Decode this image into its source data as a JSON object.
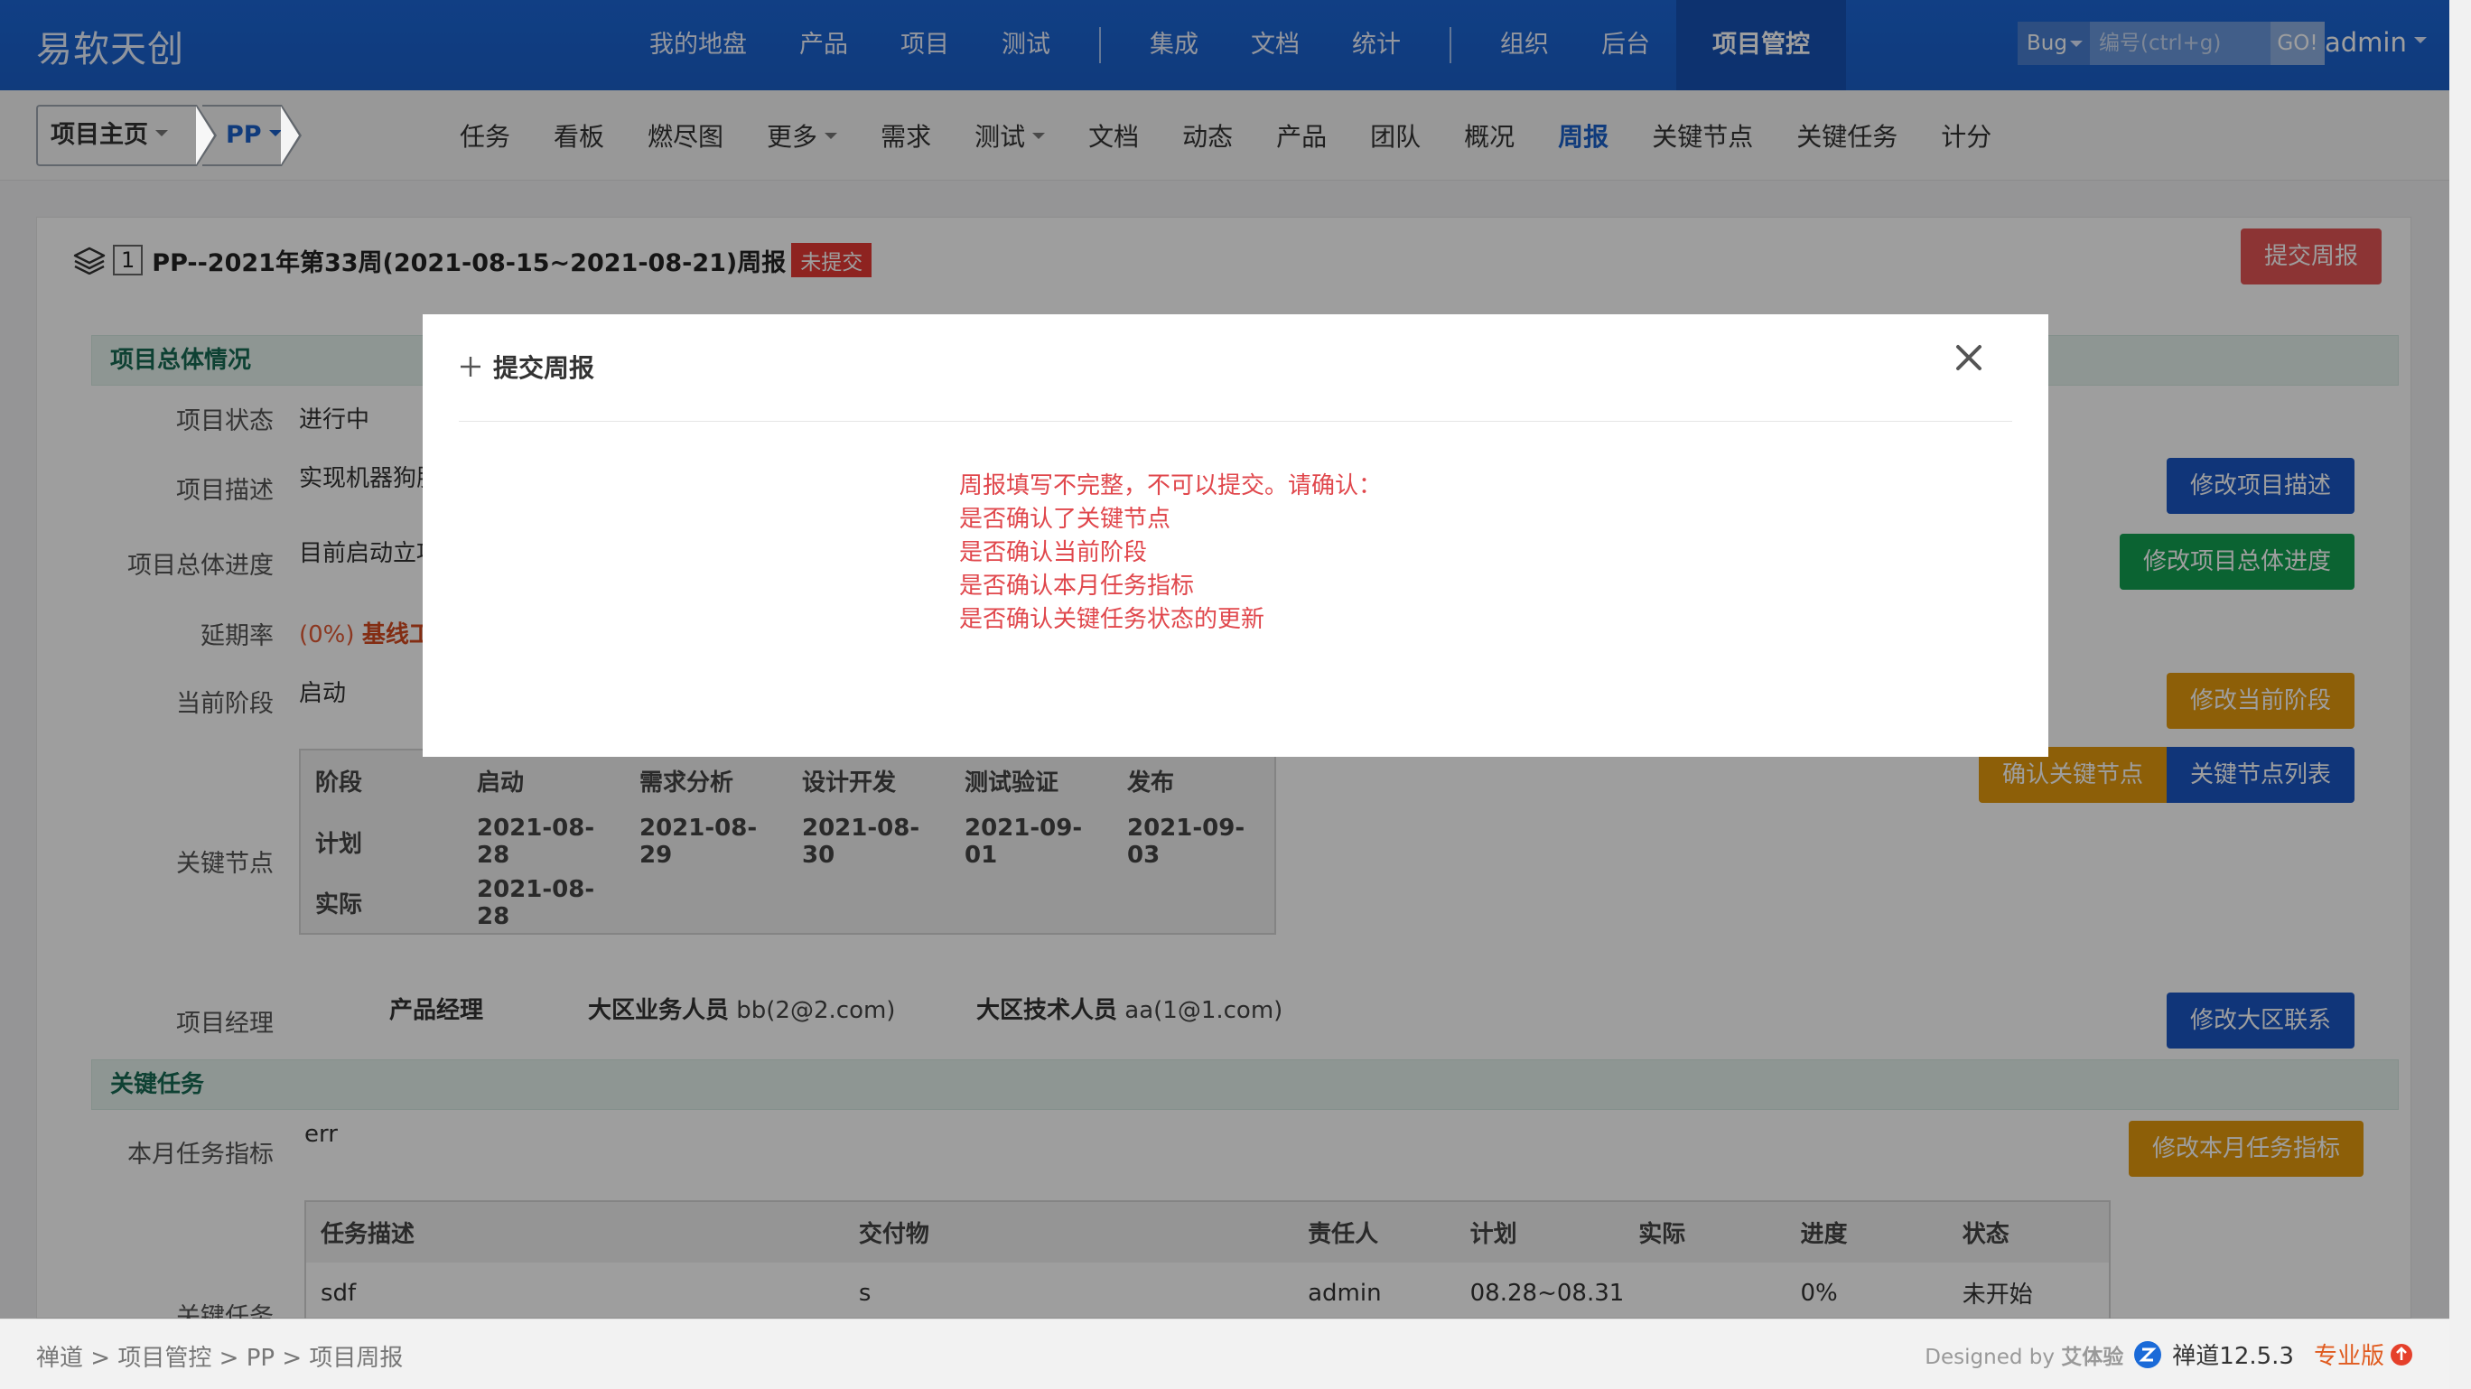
{
  "header": {
    "brand": "易软天创",
    "nav": [
      "我的地盘",
      "产品",
      "项目",
      "测试",
      "集成",
      "文档",
      "统计",
      "组织",
      "后台"
    ],
    "active": "项目管控",
    "search_type": "Bug",
    "search_placeholder": "编号(ctrl+g)",
    "go_label": "GO!",
    "user": "admin"
  },
  "subnav": {
    "home": "项目主页",
    "project": "PP",
    "items": [
      "任务",
      "看板",
      "燃尽图",
      "更多",
      "需求",
      "测试",
      "文档",
      "动态",
      "产品",
      "团队",
      "概况",
      "周报",
      "关键节点",
      "关键任务",
      "计分"
    ],
    "active_index": 11
  },
  "report": {
    "number": "1",
    "title": "PP--2021年第33周(2021-08-15~2021-08-21)周报",
    "status_badge": "未提交",
    "submit_label": "提交周报"
  },
  "overview": {
    "section": "项目总体情况",
    "status_label": "项目状态",
    "status_value": "进行中",
    "desc_label": "项目描述",
    "desc_value": "实现机器狗服",
    "progress_label": "项目总体进度",
    "progress_value": "目前启动立项",
    "delay_label": "延期率",
    "delay_pct": "(0%)",
    "delay_text": "基线工",
    "stage_label": "当前阶段",
    "stage_value": "启动",
    "milestone_label": "关键节点",
    "manager_label": "项目经理"
  },
  "milestones": {
    "headers": [
      "阶段",
      "启动",
      "需求分析",
      "设计开发",
      "测试验证",
      "发布"
    ],
    "plan": [
      "计划",
      "2021-08-28",
      "2021-08-29",
      "2021-08-30",
      "2021-09-01",
      "2021-09-03"
    ],
    "actual": [
      "实际",
      "2021-08-28",
      "",
      "",
      "",
      ""
    ]
  },
  "contacts": {
    "pm_label": "产品经理",
    "biz_label": "大区业务人员",
    "biz_value": "bb(2@2.com)",
    "tech_label": "大区技术人员",
    "tech_value": "aa(1@1.com)"
  },
  "buttons": {
    "edit_desc": "修改项目描述",
    "edit_progress": "修改项目总体进度",
    "edit_stage": "修改当前阶段",
    "confirm_milestone": "确认关键节点",
    "milestone_list": "关键节点列表",
    "edit_region": "修改大区联系",
    "edit_monthly": "修改本月任务指标"
  },
  "keytasks": {
    "section": "关键任务",
    "monthly_label": "本月任务指标",
    "monthly_value": "err",
    "tasks_label": "关键任务",
    "headers": [
      "任务描述",
      "交付物",
      "责任人",
      "计划",
      "实际",
      "进度",
      "状态"
    ],
    "rows": [
      [
        "sdf",
        "s",
        "admin",
        "08.28~08.31",
        "",
        "0%",
        "未开始"
      ]
    ]
  },
  "modal": {
    "title": "提交周报",
    "lines": [
      "周报填写不完整，不可以提交。请确认：",
      "是否确认了关键节点",
      "是否确认当前阶段",
      "是否确认本月任务指标",
      "是否确认关键任务状态的更新"
    ]
  },
  "footer": {
    "crumbs": [
      "禅道",
      "项目管控",
      "PP",
      "项目周报"
    ],
    "sep": ">",
    "designed": "Designed by",
    "designer": "艾体验",
    "version": "禅道12.5.3",
    "edition": "专业版"
  },
  "colors": {
    "header_blue": "#1a5fc9",
    "danger_red": "#e0474c",
    "section_bg": "#e6f2ee"
  }
}
